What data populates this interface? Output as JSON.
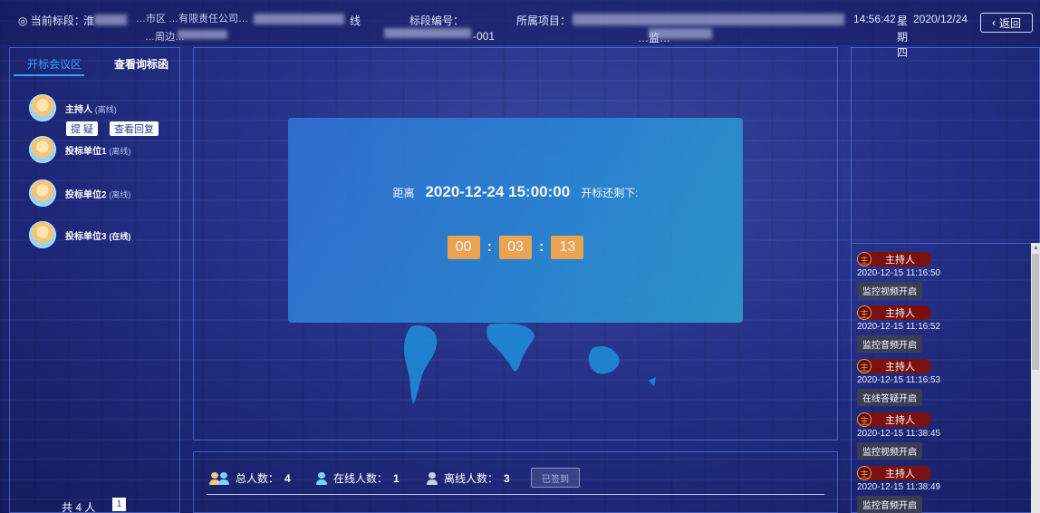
{
  "topbar": {
    "location_label": "◎ 当前标段：",
    "location_prefix": "淮",
    "location_mid": "…市区 …有限责任公司…",
    "location_tail": "线",
    "location_line2": "…周边…",
    "section_no_label": "标段编号：",
    "section_no_value": "-001",
    "project_label": "所属项目：",
    "project_value": "…监…",
    "time": "14:56:42",
    "weekday_1": "星",
    "weekday_2": "期",
    "weekday_3": "四",
    "date": "2020/12/24",
    "back_icon": "chevron-left-icon",
    "back_label": "返回"
  },
  "left": {
    "tabs": [
      {
        "label": "开标会议区",
        "active": true
      },
      {
        "label": "查看询标函",
        "active": false
      }
    ],
    "participants": [
      {
        "name": "主持人",
        "status": "(离线)"
      },
      {
        "name": "投标单位1",
        "status": "(离线)"
      },
      {
        "name": "投标单位2",
        "status": "(离线)"
      },
      {
        "name": "投标单位3",
        "status": "(在线)"
      }
    ],
    "host_buttons": [
      "提 疑",
      "查看回复"
    ],
    "total": "共 4 人",
    "page": "1"
  },
  "countdown": {
    "prefix": "距离",
    "datetime": "2020-12-24 15:00:00",
    "suffix": "开标还剩下:",
    "hh": "00",
    "mm": "03",
    "ss": "13"
  },
  "stats": {
    "total_label": "总人数：",
    "total_value": "4",
    "online_label": "在线人数：",
    "online_value": "1",
    "offline_label": "离线人数：",
    "offline_value": "3",
    "signed_label": "已签到"
  },
  "log": [
    {
      "badge": "主",
      "name": "主持人",
      "time": "2020-12-15 11:16:50",
      "action": "监控视频开启"
    },
    {
      "badge": "主",
      "name": "主持人",
      "time": "2020-12-15 11:16:52",
      "action": "监控音频开启"
    },
    {
      "badge": "主",
      "name": "主持人",
      "time": "2020-12-15 11:16:53",
      "action": "在线答疑开启"
    },
    {
      "badge": "主",
      "name": "主持人",
      "time": "2020-12-15 11:38:45",
      "action": "监控视频开启"
    },
    {
      "badge": "主",
      "name": "主持人",
      "time": "2020-12-15 11:38:49",
      "action": "监控音频开启"
    }
  ],
  "colors": {
    "accent": "#3aa0ff",
    "digit": "#f4a94f",
    "badge": "#7a1111"
  }
}
